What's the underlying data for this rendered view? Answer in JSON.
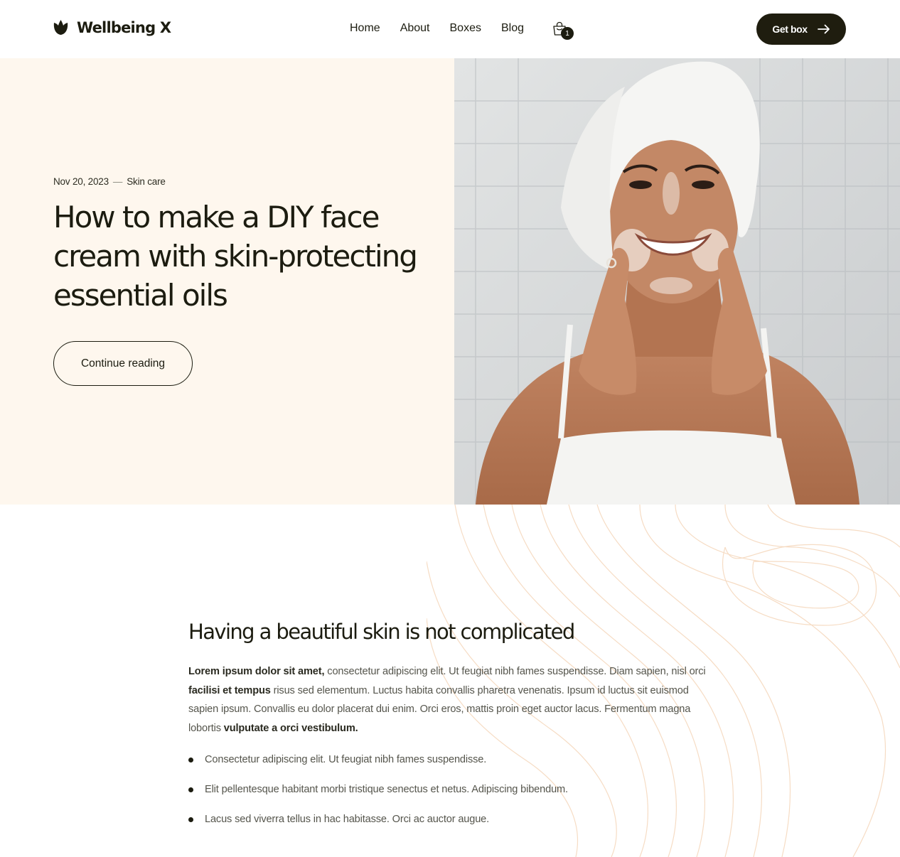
{
  "brand": {
    "name": "Wellbeing X"
  },
  "nav": {
    "items": [
      "Home",
      "About",
      "Boxes",
      "Blog"
    ]
  },
  "cart": {
    "count": "1"
  },
  "header": {
    "cta_label": "Get box"
  },
  "hero": {
    "date": "Nov 20, 2023",
    "separator": "—",
    "category": "Skin care",
    "title": "How to make a DIY face cream with skin-protecting essential oils",
    "button_label": "Continue reading"
  },
  "article": {
    "heading": "Having a beautiful skin is not complicated",
    "para": {
      "b1": "Lorem ipsum dolor sit amet,",
      "t1": " consectetur adipiscing elit. Ut feugiat nibh fames suspendisse. Diam sapien, nisl orci ",
      "b2": "facilisi et tempus",
      "t2": " risus sed elementum. Luctus habita convallis pharetra venenatis. Ipsum id luctus sit euismod sapien ipsum. Convallis eu dolor placerat dui enim. Orci eros, mattis proin eget auctor lacus. Fermentum magna lobortis ",
      "b3": "vulputate a orci vestibulum."
    },
    "bullets": [
      "Consectetur adipiscing elit. Ut feugiat nibh fames suspendisse.",
      "Elit pellentesque habitant morbi tristique senectus et netus. Adipiscing bibendum.",
      "Lacus sed viverra tellus in hac habitasse. Orci ac auctor augue."
    ]
  },
  "colors": {
    "ink": "#1c1c10",
    "cream": "#fef7ee",
    "pattern": "#f6dcc4"
  }
}
